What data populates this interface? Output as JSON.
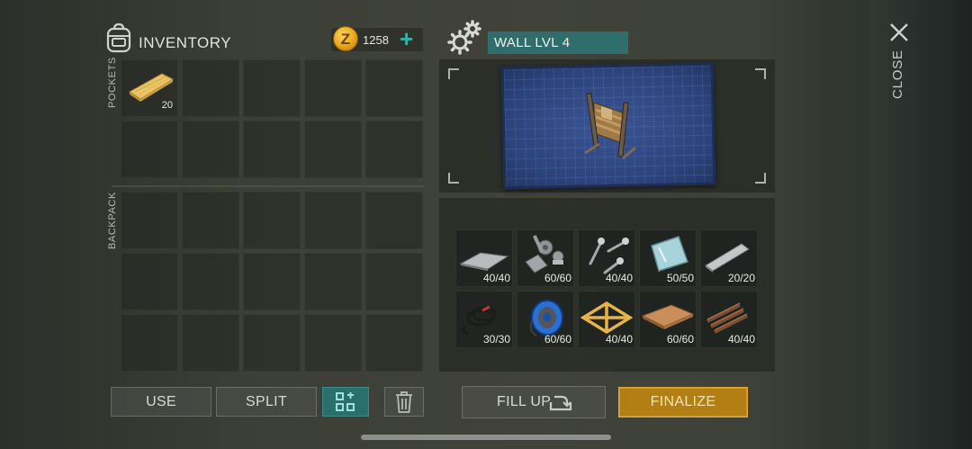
{
  "inventory": {
    "title": "INVENTORY",
    "coins": "1258",
    "pockets_label": "POCKETS",
    "backpack_label": "BACKPACK",
    "pocket_item": {
      "name": "wooden-plank",
      "count": "20"
    }
  },
  "build": {
    "title": "WALL LVL 4",
    "materials": [
      {
        "icon": "metal-plate-icon",
        "count": "40/40"
      },
      {
        "icon": "metal-parts-icon",
        "count": "60/60"
      },
      {
        "icon": "screws-icon",
        "count": "40/40"
      },
      {
        "icon": "glass-icon",
        "count": "50/50"
      },
      {
        "icon": "metal-bar-icon",
        "count": "20/20"
      },
      {
        "icon": "wires-icon",
        "count": "30/30"
      },
      {
        "icon": "wire-spool-icon",
        "count": "60/60"
      },
      {
        "icon": "wooden-frame-icon",
        "count": "40/40"
      },
      {
        "icon": "plywood-icon",
        "count": "60/60"
      },
      {
        "icon": "rope-icon",
        "count": "40/40"
      }
    ]
  },
  "buttons": {
    "use": "USE",
    "split": "SPLIT",
    "fill_up": "FILL UP",
    "finalize": "FINALIZE",
    "close": "CLOSE"
  },
  "colors": {
    "accent_teal": "#2f6e6c",
    "finalize_gold": "#b37f14",
    "plus_teal": "#34b2a6"
  }
}
